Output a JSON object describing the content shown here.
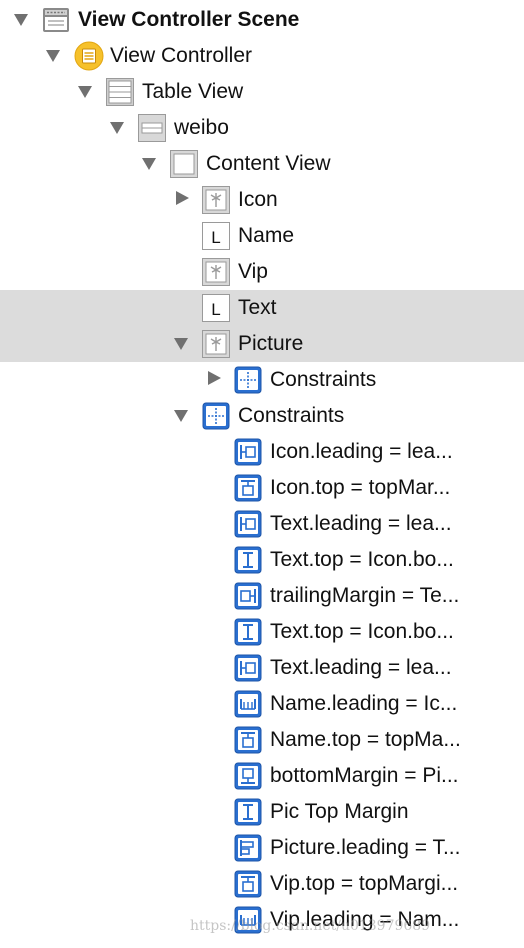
{
  "tree": [
    {
      "label": "View Controller Scene",
      "bold": true,
      "depth": 0,
      "disclosure": "open",
      "icon": "scene-icon"
    },
    {
      "label": "View Controller",
      "depth": 1,
      "disclosure": "open",
      "icon": "view-controller-icon"
    },
    {
      "label": "Table View",
      "depth": 2,
      "disclosure": "open",
      "icon": "table-view-icon"
    },
    {
      "label": "weibo",
      "depth": 3,
      "disclosure": "open",
      "icon": "table-cell-icon"
    },
    {
      "label": "Content View",
      "depth": 4,
      "disclosure": "open",
      "icon": "content-view-icon"
    },
    {
      "label": "Icon",
      "depth": 5,
      "disclosure": "closed",
      "icon": "image-view-icon"
    },
    {
      "label": "Name",
      "depth": 5,
      "disclosure": "none",
      "icon": "label-icon"
    },
    {
      "label": "Vip",
      "depth": 5,
      "disclosure": "none",
      "icon": "image-view-icon"
    },
    {
      "label": "Text",
      "depth": 5,
      "disclosure": "none",
      "icon": "label-icon",
      "selected": true
    },
    {
      "label": "Picture",
      "depth": 5,
      "disclosure": "open",
      "icon": "image-view-icon",
      "selected": true
    },
    {
      "label": "Constraints",
      "depth": 6,
      "disclosure": "closed",
      "icon": "constraints-icon"
    },
    {
      "label": "Constraints",
      "depth": 5,
      "disclosure": "open",
      "icon": "constraints-icon"
    },
    {
      "label": "Icon.leading = lea...",
      "depth": 6,
      "disclosure": "none",
      "icon": "leading-constraint-icon"
    },
    {
      "label": "Icon.top = topMar...",
      "depth": 6,
      "disclosure": "none",
      "icon": "top-constraint-icon"
    },
    {
      "label": "Text.leading = lea...",
      "depth": 6,
      "disclosure": "none",
      "icon": "leading-constraint-icon"
    },
    {
      "label": "Text.top = Icon.bo...",
      "depth": 6,
      "disclosure": "none",
      "icon": "vertical-spacing-icon"
    },
    {
      "label": "trailingMargin = Te...",
      "depth": 6,
      "disclosure": "none",
      "icon": "trailing-constraint-icon"
    },
    {
      "label": "Text.top = Icon.bo...",
      "depth": 6,
      "disclosure": "none",
      "icon": "vertical-spacing-icon"
    },
    {
      "label": "Text.leading = lea...",
      "depth": 6,
      "disclosure": "none",
      "icon": "leading-constraint-icon"
    },
    {
      "label": "Name.leading = Ic...",
      "depth": 6,
      "disclosure": "none",
      "icon": "horizontal-spacing-icon"
    },
    {
      "label": "Name.top = topMa...",
      "depth": 6,
      "disclosure": "none",
      "icon": "top-constraint-icon"
    },
    {
      "label": "bottomMargin = Pi...",
      "depth": 6,
      "disclosure": "none",
      "icon": "bottom-constraint-icon"
    },
    {
      "label": "Pic Top Margin",
      "depth": 6,
      "disclosure": "none",
      "icon": "vertical-spacing-icon"
    },
    {
      "label": "Picture.leading = T...",
      "depth": 6,
      "disclosure": "none",
      "icon": "leading-align-icon"
    },
    {
      "label": "Vip.top = topMargi...",
      "depth": 6,
      "disclosure": "none",
      "icon": "top-constraint-icon"
    },
    {
      "label": "Vip.leading = Nam...",
      "depth": 6,
      "disclosure": "none",
      "icon": "horizontal-spacing-icon"
    }
  ],
  "watermark": "https://blog.csdn.net/u013979689",
  "colors": {
    "selection": "#dcdcdc",
    "constraint_blue": "#2a6fd0",
    "disclosure": "#707070",
    "folder_yellow": "#f6c12b"
  }
}
